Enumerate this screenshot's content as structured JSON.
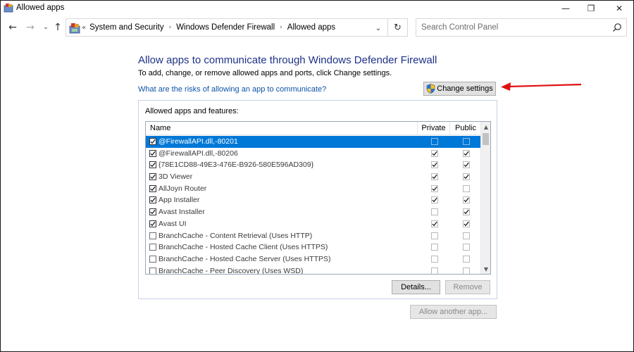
{
  "window": {
    "title": "Allowed apps",
    "controls": {
      "minimize": "—",
      "maximize": "❐",
      "close": "✕"
    }
  },
  "address": {
    "prefix": "«",
    "crumbs": [
      "System and Security",
      "Windows Defender Firewall",
      "Allowed apps"
    ],
    "separator": "›"
  },
  "search": {
    "placeholder": "Search Control Panel"
  },
  "main": {
    "heading": "Allow apps to communicate through Windows Defender Firewall",
    "subtext": "To add, change, or remove allowed apps and ports, click Change settings.",
    "risk_link": "What are the risks of allowing an app to communicate?",
    "change_settings_label": "Change settings",
    "group_label": "Allowed apps and features:",
    "columns": {
      "name": "Name",
      "private": "Private",
      "public": "Public"
    },
    "apps": [
      {
        "name": "@FirewallAPI.dll,-80201",
        "enabled": true,
        "private": false,
        "public": false,
        "selected": true
      },
      {
        "name": "@FirewallAPI.dll,-80206",
        "enabled": true,
        "private": true,
        "public": true,
        "selected": false
      },
      {
        "name": "{78E1CD88-49E3-476E-B926-580E596AD309}",
        "enabled": true,
        "private": true,
        "public": true,
        "selected": false
      },
      {
        "name": "3D Viewer",
        "enabled": true,
        "private": true,
        "public": true,
        "selected": false
      },
      {
        "name": "AllJoyn Router",
        "enabled": true,
        "private": true,
        "public": false,
        "selected": false
      },
      {
        "name": "App Installer",
        "enabled": true,
        "private": true,
        "public": true,
        "selected": false
      },
      {
        "name": "Avast Installer",
        "enabled": true,
        "private": false,
        "public": true,
        "selected": false
      },
      {
        "name": "Avast UI",
        "enabled": true,
        "private": true,
        "public": true,
        "selected": false
      },
      {
        "name": "BranchCache - Content Retrieval (Uses HTTP)",
        "enabled": false,
        "private": false,
        "public": false,
        "selected": false
      },
      {
        "name": "BranchCache - Hosted Cache Client (Uses HTTPS)",
        "enabled": false,
        "private": false,
        "public": false,
        "selected": false
      },
      {
        "name": "BranchCache - Hosted Cache Server (Uses HTTPS)",
        "enabled": false,
        "private": false,
        "public": false,
        "selected": false
      },
      {
        "name": "BranchCache - Peer Discovery (Uses WSD)",
        "enabled": false,
        "private": false,
        "public": false,
        "selected": false
      }
    ],
    "details_label": "Details...",
    "remove_label": "Remove",
    "allow_another_label": "Allow another app..."
  },
  "colors": {
    "heading": "#1e3287",
    "link": "#0f53a9",
    "selection": "#0078d7",
    "annotation_arrow": "#e01010"
  }
}
